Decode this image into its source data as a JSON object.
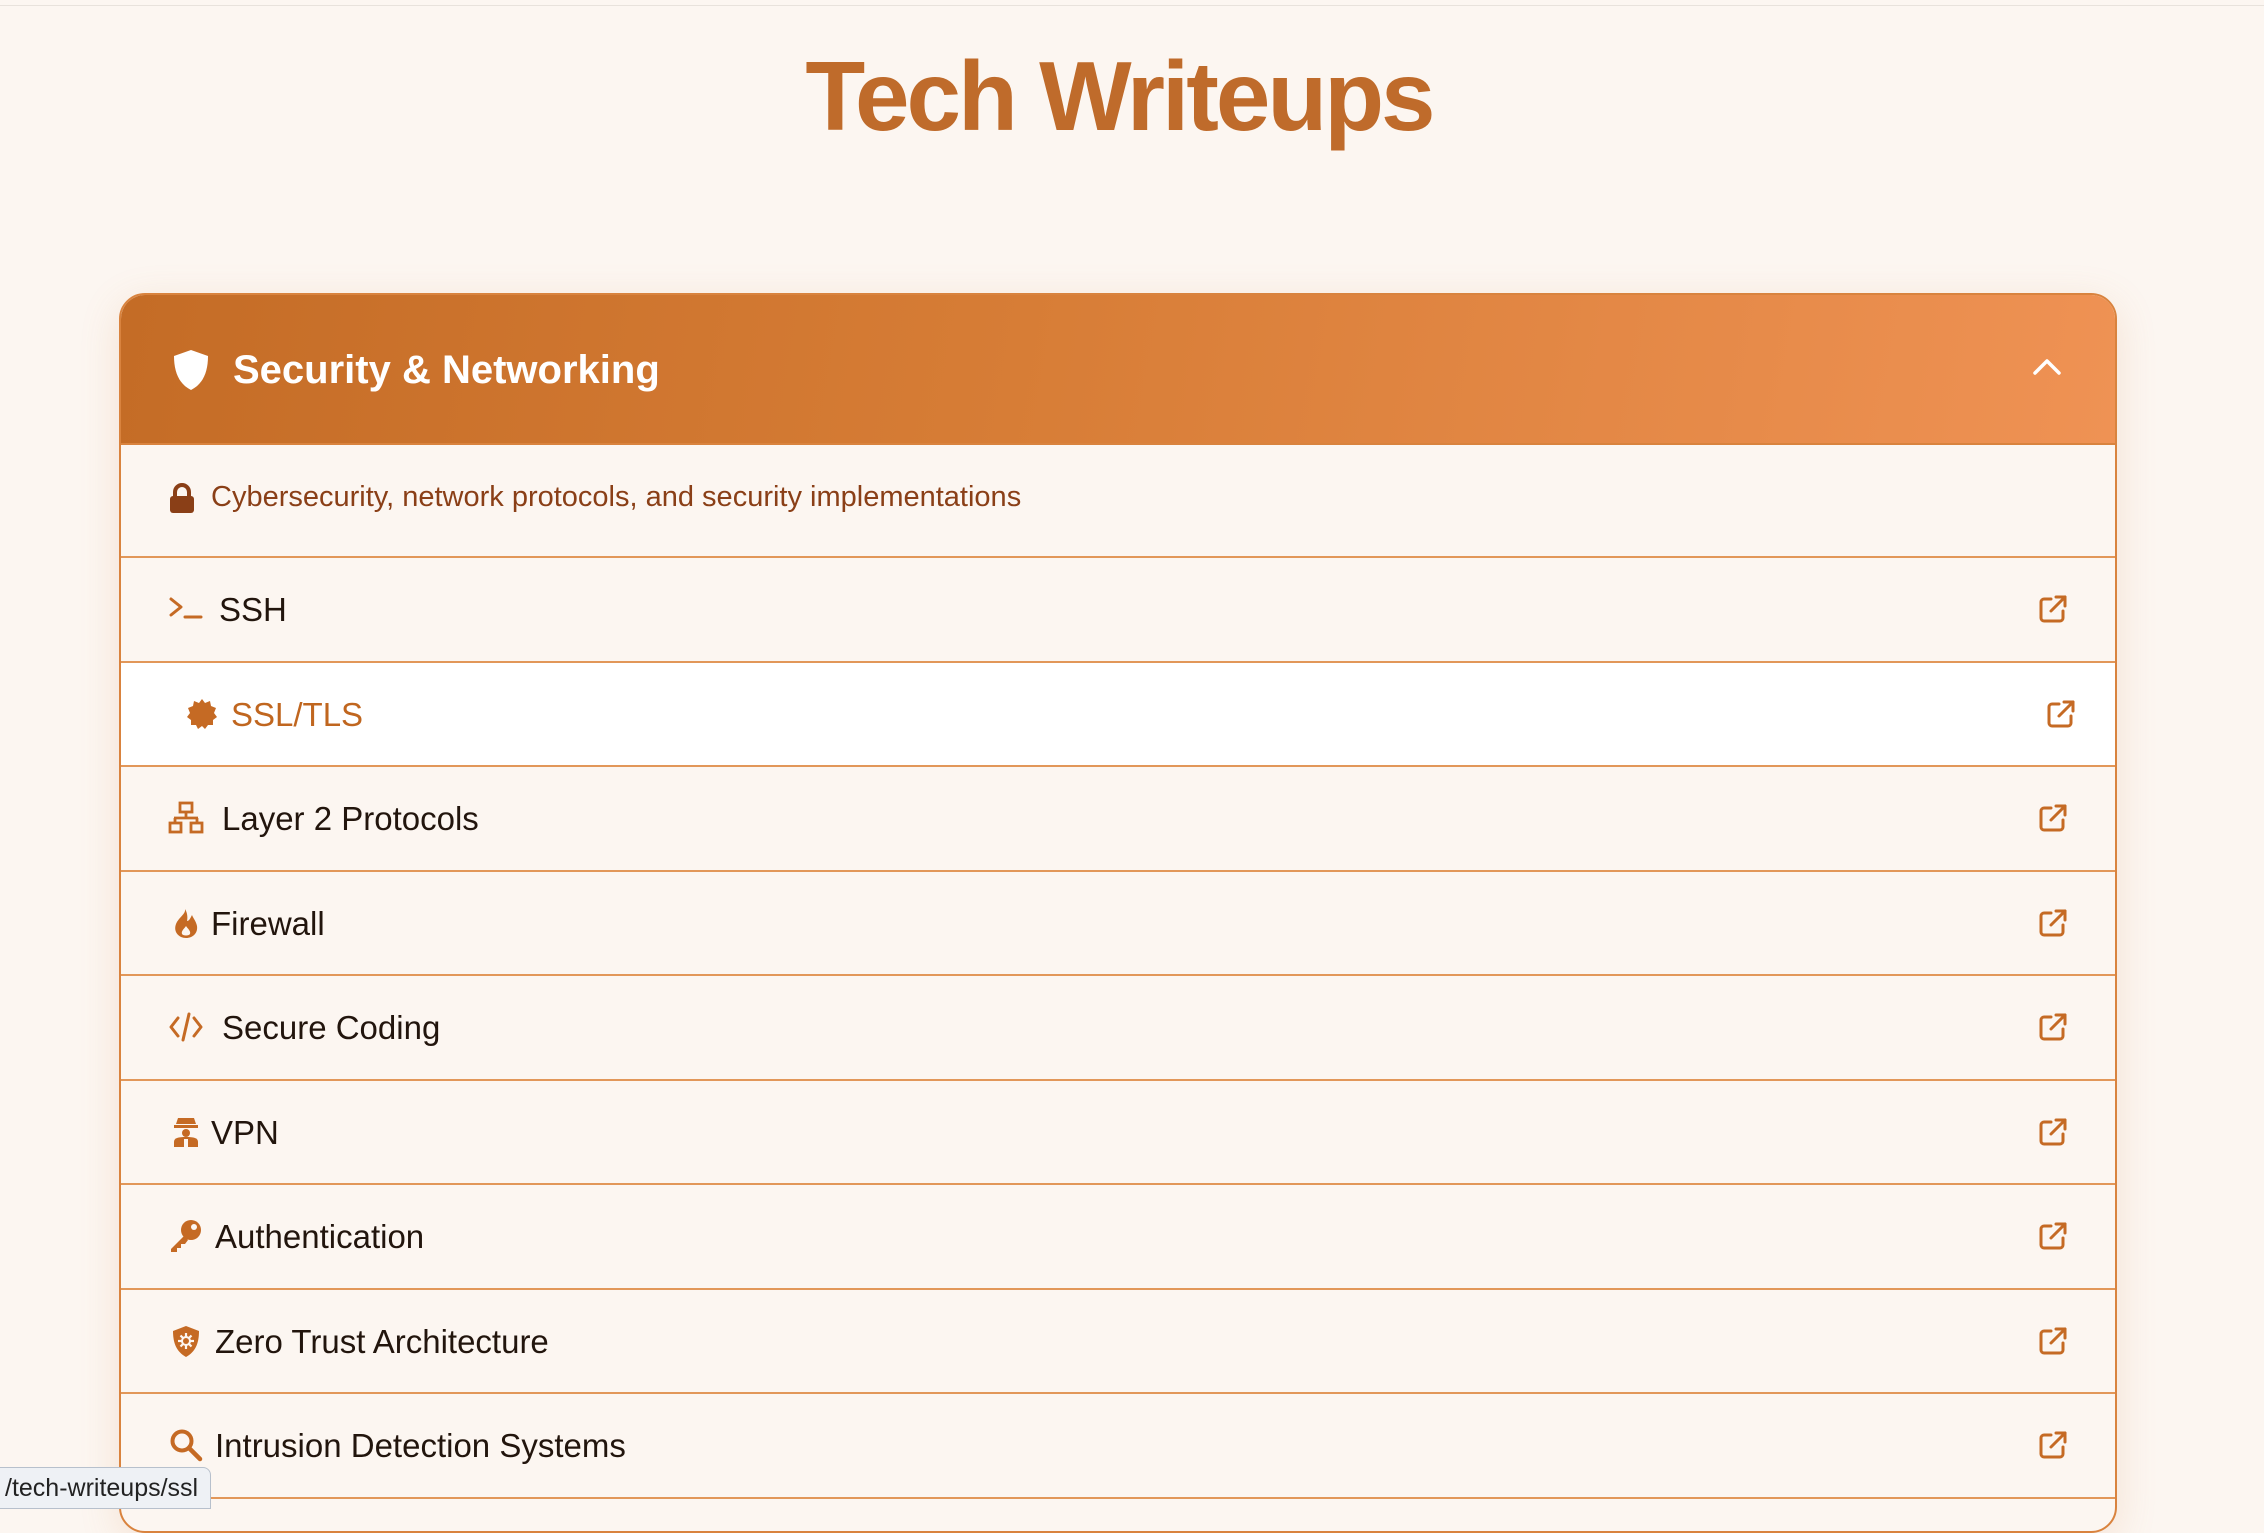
{
  "page": {
    "title": "Tech Writeups"
  },
  "section": {
    "title": "Security & Networking",
    "icon": "shield-icon",
    "collapse_icon": "chevron-up-icon",
    "description": "Cybersecurity, network protocols, and security implementations",
    "description_icon": "lock-icon",
    "items": [
      {
        "label": "SSH",
        "icon": "terminal-icon"
      },
      {
        "label": "SSL/TLS",
        "icon": "certificate-icon"
      },
      {
        "label": "Layer 2 Protocols",
        "icon": "network-icon"
      },
      {
        "label": "Firewall",
        "icon": "fire-icon"
      },
      {
        "label": "Secure Coding",
        "icon": "code-icon"
      },
      {
        "label": "VPN",
        "icon": "vpn-icon"
      },
      {
        "label": "Authentication",
        "icon": "key-icon"
      },
      {
        "label": "Zero Trust Architecture",
        "icon": "shield-virus-icon"
      },
      {
        "label": "Intrusion Detection Systems",
        "icon": "search-icon"
      }
    ],
    "item_action_icon": "external-link-icon"
  },
  "status_bar": {
    "url": "/tech-writeups/ssl"
  },
  "colors": {
    "accent": "#c56a24",
    "header_gradient_start": "#c46c26",
    "header_gradient_end": "#ef9254",
    "background": "#fcf6f1"
  }
}
